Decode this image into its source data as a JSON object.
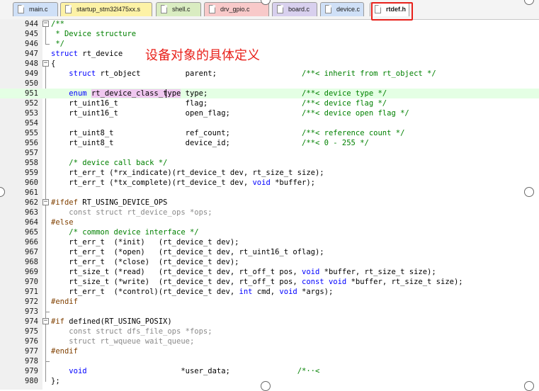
{
  "tabs": [
    {
      "label": "main.c",
      "color": "#cfe0f7",
      "active": false
    },
    {
      "label": "startup_stm32l475xx.s",
      "color": "#fdf2a6",
      "active": false
    },
    {
      "label": "shell.c",
      "color": "#d9ecc1",
      "active": false
    },
    {
      "label": "drv_gpio.c",
      "color": "#f8c9c9",
      "active": false
    },
    {
      "label": "board.c",
      "color": "#d8d0ee",
      "active": false
    },
    {
      "label": "device.c",
      "color": "#cfe0f7",
      "active": false
    },
    {
      "label": "rtdef.h",
      "color": "#ffffff",
      "active": true
    }
  ],
  "annotation": "设备对象的具体定义",
  "lines": [
    {
      "n": "944",
      "fold": "minus",
      "segs": [
        [
          "/**",
          "cm"
        ]
      ]
    },
    {
      "n": "945",
      "fold": "",
      "segs": [
        [
          " * Device structure",
          "cm"
        ]
      ]
    },
    {
      "n": "946",
      "fold": "end",
      "segs": [
        [
          " */",
          "cm"
        ]
      ]
    },
    {
      "n": "947",
      "fold": "",
      "segs": [
        [
          "struct",
          "kw"
        ],
        [
          " rt_device",
          ""
        ]
      ]
    },
    {
      "n": "948",
      "fold": "minus",
      "segs": [
        [
          "{",
          ""
        ]
      ]
    },
    {
      "n": "949",
      "fold": "",
      "segs": [
        [
          "    ",
          ""
        ],
        [
          "struct",
          "kw"
        ],
        [
          " rt_object          parent;                   ",
          ""
        ],
        [
          "/**< inherit from rt_object */",
          "cm"
        ]
      ]
    },
    {
      "n": "950",
      "fold": "",
      "segs": []
    },
    {
      "n": "951",
      "fold": "",
      "hl": true,
      "segs": [
        [
          "    ",
          ""
        ],
        [
          "enum",
          "kw"
        ],
        [
          " ",
          ""
        ],
        [
          "rt_device_class_type",
          "sel"
        ],
        [
          " type;                     ",
          ""
        ],
        [
          "/**< device type */",
          "cm"
        ]
      ]
    },
    {
      "n": "952",
      "fold": "",
      "segs": [
        [
          "    rt_uint16_t               flag;                     ",
          ""
        ],
        [
          "/**< device flag */",
          "cm"
        ]
      ]
    },
    {
      "n": "953",
      "fold": "",
      "segs": [
        [
          "    rt_uint16_t               open_flag;                ",
          ""
        ],
        [
          "/**< device open flag */",
          "cm"
        ]
      ]
    },
    {
      "n": "954",
      "fold": "",
      "segs": []
    },
    {
      "n": "955",
      "fold": "",
      "segs": [
        [
          "    rt_uint8_t                ref_count;                ",
          ""
        ],
        [
          "/**< reference count */",
          "cm"
        ]
      ]
    },
    {
      "n": "956",
      "fold": "",
      "segs": [
        [
          "    rt_uint8_t                device_id;                ",
          ""
        ],
        [
          "/**< 0 - 255 */",
          "cm"
        ]
      ]
    },
    {
      "n": "957",
      "fold": "",
      "segs": []
    },
    {
      "n": "958",
      "fold": "",
      "segs": [
        [
          "    ",
          ""
        ],
        [
          "/* device call back */",
          "cm"
        ]
      ]
    },
    {
      "n": "959",
      "fold": "",
      "segs": [
        [
          "    rt_err_t (*rx_indicate)(rt_device_t dev, rt_size_t size);",
          ""
        ]
      ]
    },
    {
      "n": "960",
      "fold": "",
      "segs": [
        [
          "    rt_err_t (*tx_complete)(rt_device_t dev, ",
          ""
        ],
        [
          "void",
          "kw"
        ],
        [
          " *buffer);",
          ""
        ]
      ]
    },
    {
      "n": "961",
      "fold": "",
      "segs": []
    },
    {
      "n": "962",
      "fold": "minus",
      "segs": [
        [
          "#ifdef",
          "pp"
        ],
        [
          " RT_USING_DEVICE_OPS",
          ""
        ]
      ]
    },
    {
      "n": "963",
      "fold": "",
      "segs": [
        [
          "    const struct rt_device_ops *ops;",
          "dim"
        ]
      ]
    },
    {
      "n": "964",
      "fold": "",
      "segs": [
        [
          "#else",
          "pp"
        ]
      ]
    },
    {
      "n": "965",
      "fold": "",
      "segs": [
        [
          "    ",
          ""
        ],
        [
          "/* common device interface */",
          "cm"
        ]
      ]
    },
    {
      "n": "966",
      "fold": "",
      "segs": [
        [
          "    rt_err_t  (*init)   (rt_device_t dev);",
          ""
        ]
      ]
    },
    {
      "n": "967",
      "fold": "",
      "segs": [
        [
          "    rt_err_t  (*open)   (rt_device_t dev, rt_uint16_t oflag);",
          ""
        ]
      ]
    },
    {
      "n": "968",
      "fold": "",
      "segs": [
        [
          "    rt_err_t  (*close)  (rt_device_t dev);",
          ""
        ]
      ]
    },
    {
      "n": "969",
      "fold": "",
      "segs": [
        [
          "    rt_size_t (*read)   (rt_device_t dev, rt_off_t pos, ",
          ""
        ],
        [
          "void",
          "kw"
        ],
        [
          " *buffer, rt_size_t size);",
          ""
        ]
      ]
    },
    {
      "n": "970",
      "fold": "",
      "segs": [
        [
          "    rt_size_t (*write)  (rt_device_t dev, rt_off_t pos, ",
          ""
        ],
        [
          "const",
          "kw"
        ],
        [
          " ",
          ""
        ],
        [
          "void",
          "kw"
        ],
        [
          " *buffer, rt_size_t size);",
          ""
        ]
      ]
    },
    {
      "n": "971",
      "fold": "",
      "segs": [
        [
          "    rt_err_t  (*control)(rt_device_t dev, ",
          ""
        ],
        [
          "int",
          "kw"
        ],
        [
          " cmd, ",
          ""
        ],
        [
          "void",
          "kw"
        ],
        [
          " *args);",
          ""
        ]
      ]
    },
    {
      "n": "972",
      "fold": "",
      "segs": [
        [
          "#endif",
          "pp"
        ]
      ]
    },
    {
      "n": "973",
      "fold": "end",
      "segs": []
    },
    {
      "n": "974",
      "fold": "minus",
      "segs": [
        [
          "#if",
          "pp"
        ],
        [
          " defined(RT_USING_POSIX)",
          ""
        ]
      ]
    },
    {
      "n": "975",
      "fold": "",
      "segs": [
        [
          "    const struct dfs_file_ops *fops;",
          "dim"
        ]
      ]
    },
    {
      "n": "976",
      "fold": "",
      "segs": [
        [
          "    struct rt_wqueue wait_queue;",
          "dim"
        ]
      ]
    },
    {
      "n": "977",
      "fold": "",
      "segs": [
        [
          "#endif",
          "pp"
        ]
      ]
    },
    {
      "n": "978",
      "fold": "end",
      "segs": []
    },
    {
      "n": "979",
      "fold": "",
      "segs": [
        [
          "    ",
          ""
        ],
        [
          "void",
          "kw"
        ],
        [
          "                     *user_data;               ",
          ""
        ],
        [
          "/*··<",
          "cm"
        ]
      ]
    },
    {
      "n": "980",
      "fold": "",
      "segs": [
        [
          "};",
          ""
        ]
      ]
    }
  ]
}
